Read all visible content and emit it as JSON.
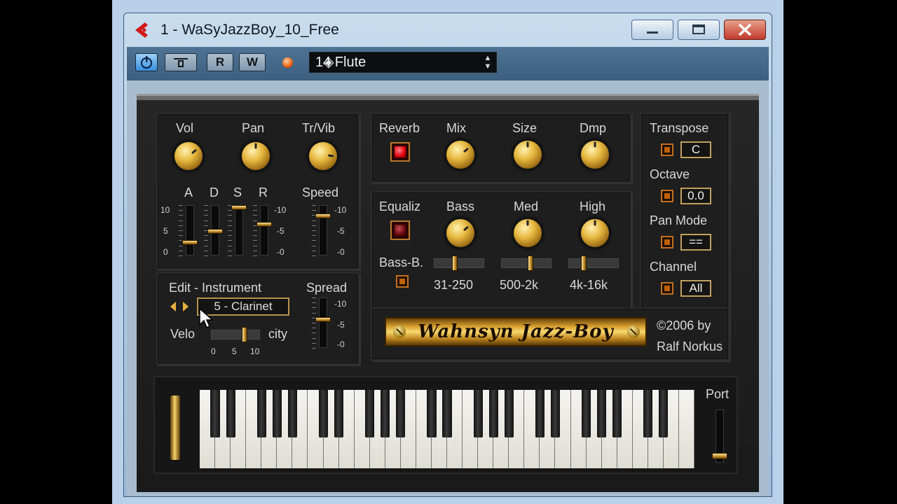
{
  "window": {
    "title": "1 - WaSyJazzBoy_10_Free",
    "buttons": {
      "minimize": "minimize-icon",
      "maximize": "maximize-icon",
      "close": "close-icon"
    }
  },
  "toolbar": {
    "power_icon": "power-icon",
    "bypass_icon": "bypass-icon",
    "read_label": "R",
    "write_label": "W",
    "preset_name": "14 Flute"
  },
  "amp": {
    "labels": {
      "vol": "Vol",
      "pan": "Pan",
      "trvib": "Tr/Vib",
      "a": "A",
      "d": "D",
      "s": "S",
      "r": "R",
      "speed": "Speed"
    },
    "scale_left": {
      "top": "10",
      "mid": "5",
      "bottom": "0"
    },
    "scale_right": {
      "top": "-10",
      "mid": "-5",
      "bottom": "-0"
    },
    "speed_scale": {
      "top": "-10",
      "mid": "-5",
      "bottom": "-0"
    }
  },
  "instrument": {
    "edit_label": "Edit - Instrument",
    "spread_label": "Spread",
    "current": "5 - Clarinet",
    "velo_label": "Velo",
    "city_label": "city",
    "velo_ticks": [
      "0",
      "5",
      "10"
    ],
    "spread_scale": {
      "top": "-10",
      "mid": "-5",
      "bottom": "-0"
    }
  },
  "reverb": {
    "labels": {
      "reverb": "Reverb",
      "mix": "Mix",
      "size": "Size",
      "dmp": "Dmp"
    }
  },
  "eq": {
    "labels": {
      "equaliz": "Equaliz",
      "bass": "Bass",
      "med": "Med",
      "high": "High",
      "bassb": "Bass-B."
    },
    "ranges": [
      "31-250",
      "500-2k",
      "4k-16k"
    ]
  },
  "right_panel": {
    "transpose_label": "Transpose",
    "transpose_value": "C",
    "octave_label": "Octave",
    "octave_value": "0.0",
    "panmode_label": "Pan Mode",
    "panmode_value": "==",
    "channel_label": "Channel",
    "channel_value": "All"
  },
  "brand": {
    "logo": "Wahnsyn Jazz-Boy",
    "copyright_line1": "©2006 by",
    "copyright_line2": "Ralf Norkus"
  },
  "keyboard": {
    "port_label": "Port"
  }
}
